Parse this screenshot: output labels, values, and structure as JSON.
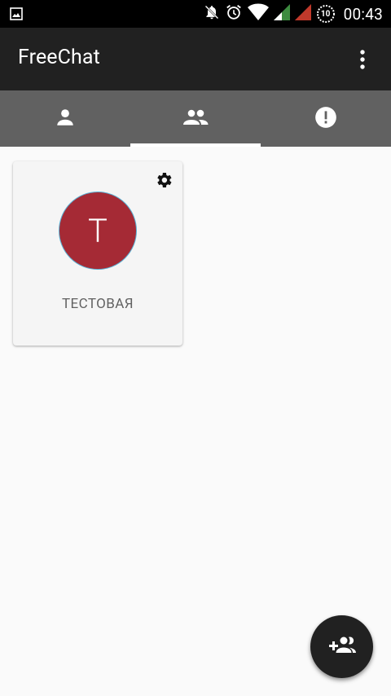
{
  "status_bar": {
    "time": "00:43",
    "battery_level": "10",
    "icons": [
      "image-notification-icon",
      "notifications-off-icon",
      "alarm-icon",
      "wifi-icon",
      "signal-icon",
      "signal-icon",
      "battery-icon"
    ]
  },
  "app_bar": {
    "title": "FreeChat",
    "menu_icon": "more-vert-icon"
  },
  "tabs": [
    {
      "icon": "person-icon",
      "active": false
    },
    {
      "icon": "group-icon",
      "active": true
    },
    {
      "icon": "alert-icon",
      "active": false
    }
  ],
  "groups": [
    {
      "initial": "Т",
      "name": "ТЕСТОВАЯ",
      "avatar_color": "#a52a35",
      "settings_icon": "gear-icon"
    }
  ],
  "fab": {
    "icon": "group-add-icon"
  },
  "colors": {
    "app_bar": "#212121",
    "tab_bar": "#616161",
    "avatar": "#a52a35",
    "background": "#fafafa"
  }
}
